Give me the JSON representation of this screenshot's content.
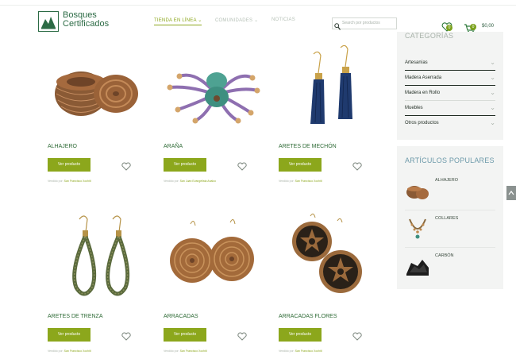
{
  "brand": {
    "line1": "Bosques",
    "line2": "Certificados"
  },
  "nav": {
    "items": [
      {
        "label": "TIENDA EN LÍNEA ⌄",
        "active": true
      },
      {
        "label": "COMUNIDADES ⌄",
        "active": false
      },
      {
        "label": "NOTICIAS",
        "active": false
      }
    ]
  },
  "search": {
    "placeholder": "Search por productos"
  },
  "wishlist": {
    "count": "0"
  },
  "cart": {
    "count": "0",
    "total": "$0,00"
  },
  "products": [
    {
      "name": "ALHAJERO",
      "button": "Ver producto",
      "vendor_prefix": "Vendido por:",
      "vendor": "San Francisco Xochitl"
    },
    {
      "name": "ARAÑA",
      "button": "Ver producto",
      "vendor_prefix": "Vendido por:",
      "vendor": "San Juan Evangelista Analco"
    },
    {
      "name": "ARETES DE MECHÓN",
      "button": "Ver producto",
      "vendor_prefix": "Vendido por:",
      "vendor": "San Francisco Xochitl"
    },
    {
      "name": "ARETES DE TRENZA",
      "button": "Ver producto",
      "vendor_prefix": "Vendido por:",
      "vendor": "San Francisco Xochitl"
    },
    {
      "name": "ARRACADAS",
      "button": "Ver producto",
      "vendor_prefix": "Vendido por:",
      "vendor": "San Francisco Xochitl"
    },
    {
      "name": "ARRACADAS FLORES",
      "button": "Ver producto",
      "vendor_prefix": "Vendido por:",
      "vendor": "San Francisco Xochitl"
    }
  ],
  "categories": {
    "title": "CATEGORÍAS",
    "items": [
      "Artesanías",
      "Madera Aserrada",
      "Madera en Rollo",
      "Muebles",
      "Otros productos"
    ]
  },
  "popular": {
    "title": "ARTÍCULOS POPULARES",
    "items": [
      "ALHAJERO",
      "COLLARES",
      "CARBÓN"
    ]
  },
  "colors": {
    "accent": "#8ca71c",
    "brand": "#2c6b45"
  }
}
